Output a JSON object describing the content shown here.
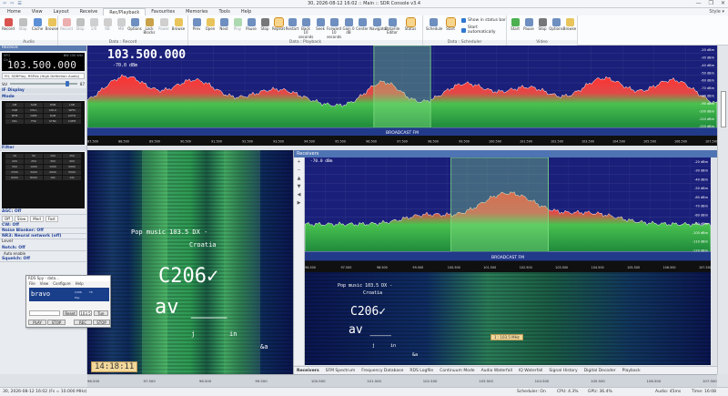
{
  "window": {
    "title": "30, 2026-08-12 16:02 :: Main :: SDR Console v3.4",
    "quick_access": [
      "⇦",
      "⇨",
      "☰"
    ],
    "buttons": [
      "—",
      "❐",
      "✕"
    ]
  },
  "menu": {
    "tabs": [
      "Home",
      "View",
      "Layout",
      "Receive",
      "Rec/Playback",
      "Favourites",
      "Memories",
      "Tools",
      "Help"
    ],
    "active": "Rec/Playback",
    "style_label": "Style ▾"
  },
  "ribbon": {
    "groups": [
      {
        "title": "Audio",
        "buttons": [
          "Record",
          "Stop",
          "Cache",
          "Browse"
        ]
      },
      {
        "title": "Data : Record",
        "buttons": [
          "Record",
          "Stop",
          "1/0",
          "KB",
          "MB",
          "Options",
          "Lock Blocks",
          "Power",
          "Browse"
        ]
      },
      {
        "title": "Data : Playback",
        "buttons": [
          "Prev",
          "Open",
          "Next",
          "Play",
          "Pause",
          "Stop",
          "Repeat",
          "Restart",
          "Back 10 seconds",
          "Seek",
          "Forward 10 seconds",
          "Gain 0 dB",
          "Center",
          "Navigator",
          "DataFile Editor",
          "Status"
        ]
      },
      {
        "title": "Data : Scheduler",
        "buttons": [
          "Schedule",
          "Start"
        ],
        "checks": [
          "Show in status bar",
          "Start automatically"
        ]
      },
      {
        "title": "Video",
        "buttons": [
          "Start",
          "Pause",
          "Stop",
          "Options",
          "Browse"
        ]
      }
    ]
  },
  "left": {
    "header": "Receive",
    "vfo": "103.500.000",
    "vfo_small": [
      "VFO",
      "Ch 1",
      "BW 150 kHz"
    ],
    "device": "FH, SDRPlay, RSPdx (High Definition Audio)",
    "volume_label": "Vol",
    "volume_value": "87",
    "volume_level": 0.85,
    "sections": [
      "IF Display",
      "Mode",
      "Filter"
    ],
    "mode_buttons": [
      "AM",
      "SAM",
      "DSB",
      "LSB",
      "USB",
      "CW-L",
      "CW-U",
      "WFM",
      "NFM",
      "DRM",
      "DAB",
      "AUTO",
      "DIG",
      "FSK",
      "SYNC",
      "C4FM"
    ],
    "filter_buttons": [
      "10",
      "50",
      "100",
      "150",
      "200",
      "250",
      "300",
      "400",
      "500",
      "1000",
      "1500",
      "2000",
      "2500",
      "3000",
      "4000",
      "5000",
      "6000",
      "8000",
      "10k",
      "12k"
    ],
    "agc": "AGC: Off",
    "agc_buttons": [
      "Off",
      "Slow",
      "Med",
      "Fast"
    ],
    "cw": "CW: Off",
    "nb": "Noise Blanker: Off",
    "nr": "NR3: Neural network (off)",
    "level_label": "Level",
    "notch": "Notch: Off",
    "auto_enable": "Auto enable",
    "squelch": "Squelch: Off"
  },
  "mini": {
    "title": "RDS Spy - data...",
    "menu": [
      "File",
      "View",
      "Configure",
      "Help"
    ],
    "ps": "bravo",
    "pi": "C206",
    "tp": "TP",
    "pty": "Pop",
    "buttons": [
      "PLAY",
      "STOP",
      "Reset",
      "REC",
      "STOP",
      "Tun"
    ],
    "freq": "103.5"
  },
  "spectrum": {
    "freq": "103.500.000",
    "level": "-70.0 dBm",
    "band": "BROADCAST FM",
    "db_ticks": [
      "-20 dBm",
      "-30 dBm",
      "-40 dBm",
      "-50 dBm",
      "-60 dBm",
      "-70 dBm",
      "-80 dBm",
      "-90 dBm",
      "-100 dBm",
      "-110 dBm",
      "-120 dBm"
    ],
    "freq_ticks": [
      "87.500",
      "88.500",
      "89.500",
      "90.500",
      "91.500",
      "92.500",
      "93.500",
      "94.500",
      "95.500",
      "96.500",
      "97.500",
      "98.500",
      "99.500",
      "100.500",
      "101.500",
      "102.500",
      "103.500",
      "104.500",
      "105.500",
      "106.500",
      "107.500"
    ],
    "ch_label": "VFO 1",
    "mode": "WFM"
  },
  "waterfall": {
    "lines": [
      "Pop music   103.5   DX  -",
      "Croatia"
    ],
    "big1": "C206✓",
    "big2": "av   ___",
    "small": [
      "j",
      "in",
      "&a"
    ],
    "clock": "14:18:11"
  },
  "receivers": {
    "title": "Receivers",
    "level": "-70.0 dBm",
    "band": "BROADCAST FM",
    "tooltip": "1 : 103.5 MHz",
    "tabs": [
      "Receivers",
      "SFM Spectrum",
      "Frequency Database",
      "RDS Logfile",
      "Continuum Mode",
      "Audio Waterfall",
      "IQ Waterfall",
      "Signal History",
      "Digital Decoder",
      "Playback"
    ]
  },
  "scale": {
    "ticks": [
      "96.500",
      "97.500",
      "98.500",
      "99.500",
      "100.500",
      "101.500",
      "102.500",
      "103.500",
      "104.500",
      "105.500",
      "106.500",
      "107.500"
    ]
  },
  "status": {
    "left": "30, 2026-08-12 16:02 (Fs = 10.000 MHz)",
    "scheduler": "Scheduler: On",
    "cpu": "CPU: 4.3%",
    "gpu": "GPU: 36.4%",
    "audio": "Audio: 45ms",
    "time": "Time: 16:08"
  },
  "colors": {
    "spectrum_bg": "#1a1f7a",
    "accent": "#4e74b3",
    "passband": "#7fdc7f"
  }
}
